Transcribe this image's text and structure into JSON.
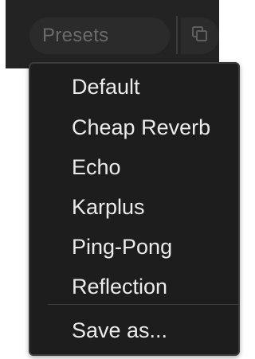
{
  "presets": {
    "label": "Presets",
    "copy_icon": "copy-icon"
  },
  "menu": {
    "items": [
      "Default",
      "Cheap Reverb",
      "Echo",
      "Karplus",
      "Ping-Pong",
      "Reflection"
    ],
    "save_as": "Save as..."
  }
}
